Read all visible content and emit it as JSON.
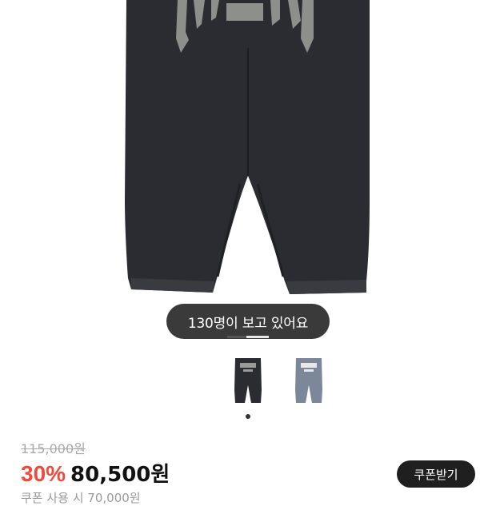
{
  "product": {
    "viewers_text": "130명이 보고 있어요",
    "images": [
      {
        "color": "#2b2c31",
        "label": "black-denim-pants"
      },
      {
        "color": "#7c8799",
        "label": "light-blue-denim-pants"
      }
    ]
  },
  "pricing": {
    "original_price": "115,000원",
    "discount": "30%",
    "sale_price": "80,500원",
    "coupon_button": "쿠폰받기",
    "coupon_note_partial": "쿠폰 사용 시 70,000원"
  },
  "colors": {
    "discount": "#f0493e",
    "pill_bg": "#3a3a3a",
    "button_bg": "#1f1f1f"
  }
}
